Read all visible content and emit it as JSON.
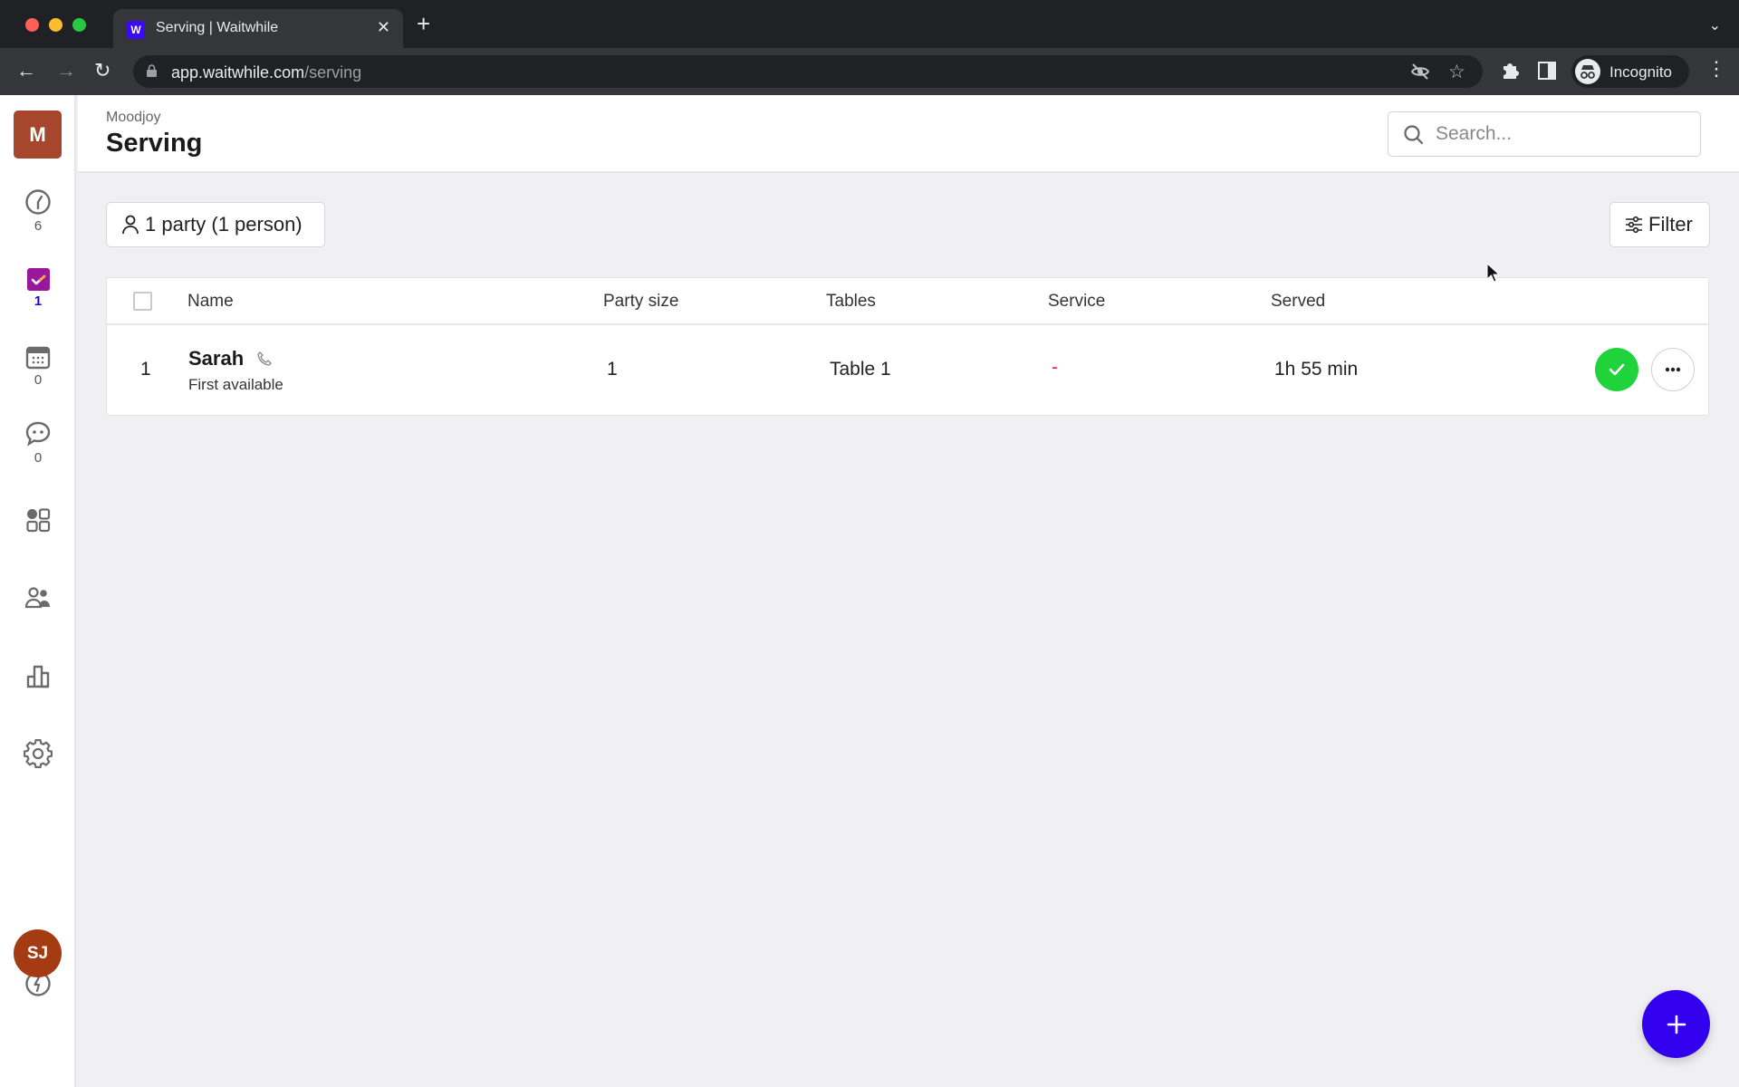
{
  "browser": {
    "tab_title": "Serving | Waitwhile",
    "favicon_letter": "W",
    "url_host": "app.waitwhile.com",
    "url_path": "/serving",
    "profile_label": "Incognito",
    "colors": {
      "close": "#ff5f57",
      "minimize": "#febc2e",
      "maximize": "#28c840"
    }
  },
  "sidebar": {
    "org_initial": "M",
    "items": [
      {
        "icon": "clock-icon",
        "count": "6"
      },
      {
        "icon": "serving-check-icon",
        "count": "1",
        "active": true
      },
      {
        "icon": "calendar-icon",
        "count": "0"
      },
      {
        "icon": "chat-icon",
        "count": "0"
      },
      {
        "icon": "apps-grid-icon"
      },
      {
        "icon": "users-icon"
      },
      {
        "icon": "analytics-icon"
      },
      {
        "icon": "settings-icon"
      }
    ],
    "bottom": {
      "icon": "bolt-icon",
      "user_initials": "SJ"
    }
  },
  "header": {
    "org_name": "Moodjoy",
    "page_title": "Serving",
    "search_placeholder": "Search..."
  },
  "toolbar": {
    "summary_label": "1 party (1 person)",
    "filter_label": "Filter"
  },
  "table": {
    "columns": [
      "Name",
      "Party size",
      "Tables",
      "Service",
      "Served"
    ],
    "rows": [
      {
        "index": "1",
        "name": "Sarah",
        "subtitle": "First available",
        "party_size": "1",
        "table": "Table 1",
        "service": "-",
        "served": "1h 55 min"
      }
    ]
  },
  "colors": {
    "accent": "#3300ee",
    "org_badge": "#a5462d",
    "avatar": "#a53b12",
    "serve_button": "#21d33a",
    "service_dash": "#e0245e"
  }
}
